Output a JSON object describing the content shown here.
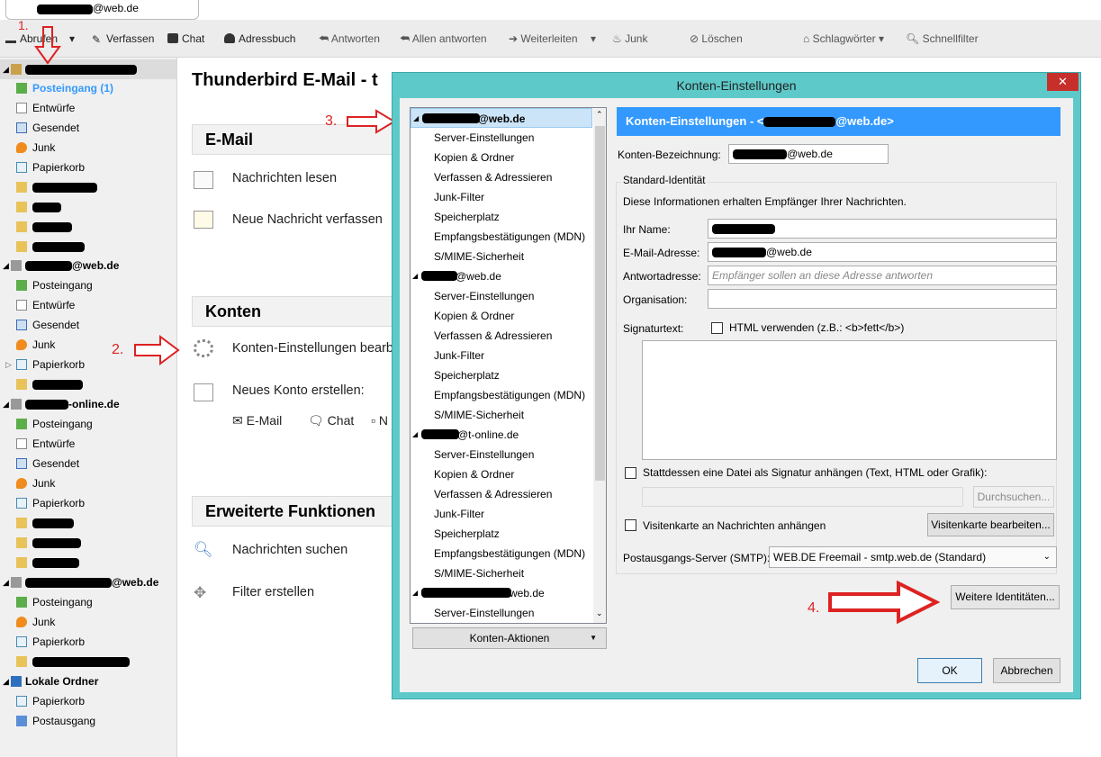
{
  "tab": {
    "title": "@web.de"
  },
  "toolbar": {
    "abrufen": "Abrufen",
    "verfassen": "Verfassen",
    "chat": "Chat",
    "adressbuch": "Adressbuch",
    "antworten": "Antworten",
    "allen_antworten": "Allen antworten",
    "weiterleiten": "Weiterleiten",
    "junk": "Junk",
    "loeschen": "Löschen",
    "schlagwoerter": "Schlagwörter",
    "schnellfilter": "Schnellfilter"
  },
  "sidebar": {
    "account1": {
      "folders": {
        "posteingang": "Posteingang (1)",
        "entwuerfe": "Entwürfe",
        "gesendet": "Gesendet",
        "junk": "Junk",
        "papierkorb": "Papierkorb"
      }
    },
    "account2": {
      "name_suffix": "@web.de",
      "folders": {
        "posteingang": "Posteingang",
        "entwuerfe": "Entwürfe",
        "gesendet": "Gesendet",
        "junk": "Junk",
        "papierkorb": "Papierkorb"
      }
    },
    "account3": {
      "name_suffix": "t-online.de",
      "folders": {
        "posteingang": "Posteingang",
        "entwuerfe": "Entwürfe",
        "gesendet": "Gesendet",
        "junk": "Junk",
        "papierkorb": "Papierkorb"
      }
    },
    "account4": {
      "name_suffix": "@web.de",
      "folders": {
        "posteingang": "Posteingang",
        "junk": "Junk",
        "papierkorb": "Papierkorb"
      }
    },
    "local": {
      "name": "Lokale Ordner",
      "folders": {
        "papierkorb": "Papierkorb",
        "postausgang": "Postausgang"
      }
    }
  },
  "main": {
    "title": "Thunderbird E-Mail - t",
    "email_section": "E-Mail",
    "nachrichten_lesen": "Nachrichten lesen",
    "neue_nachricht": "Neue Nachricht verfassen",
    "konten_section": "Konten",
    "konten_einstellungen": "Konten-Einstellungen bearb",
    "neues_konto": "Neues Konto erstellen:",
    "new_email": "E-Mail",
    "new_chat": "Chat",
    "new_more": "N",
    "erweitert_section": "Erweiterte Funktionen",
    "nachrichten_suchen": "Nachrichten suchen",
    "filter_erstellen": "Filter erstellen"
  },
  "annotations": {
    "a1": "1.",
    "a2": "2.",
    "a3": "3.",
    "a4": "4."
  },
  "dialog": {
    "title": "Konten-Einstellungen",
    "close": "✕",
    "tree": {
      "acc1": "@web.de",
      "acc2": "@web.de",
      "acc3": "@t-online.de",
      "acc4": "web.de",
      "items": [
        "Server-Einstellungen",
        "Kopien & Ordner",
        "Verfassen & Adressieren",
        "Junk-Filter",
        "Speicherplatz",
        "Empfangsbestätigungen (MDN)",
        "S/MIME-Sicherheit"
      ]
    },
    "konten_aktionen": "Konten-Aktionen",
    "header_prefix": "Konten-Einstellungen - <",
    "header_suffix": "@web.de>",
    "bezeichnung_label": "Konten-Bezeichnung:",
    "bezeichnung_value": "@web.de",
    "identitaet_group": "Standard-Identität",
    "identitaet_info": "Diese Informationen erhalten Empfänger Ihrer Nachrichten.",
    "name_label": "Ihr Name:",
    "email_label": "E-Mail-Adresse:",
    "email_value": "@web.de",
    "antwort_label": "Antwortadresse:",
    "antwort_placeholder": "Empfänger sollen an diese Adresse antworten",
    "org_label": "Organisation:",
    "signatur_label": "Signaturtext:",
    "html_label": "HTML verwenden (z.B.: <b>fett</b>)",
    "datei_label": "Stattdessen eine Datei als Signatur anhängen (Text, HTML oder Grafik):",
    "durchsuchen": "Durchsuchen...",
    "visitenkarte_label": "Visitenkarte an Nachrichten anhängen",
    "visitenkarte_btn": "Visitenkarte bearbeiten...",
    "smtp_label": "Postausgangs-Server (SMTP):",
    "smtp_value": "WEB.DE Freemail - smtp.web.de (Standard)",
    "weitere": "Weitere Identitäten...",
    "ok": "OK",
    "abbrechen": "Abbrechen"
  },
  "colors": {
    "selection": "#3399ff",
    "dialog_frame": "#5ec9c9",
    "annotation": "#dd2222"
  }
}
